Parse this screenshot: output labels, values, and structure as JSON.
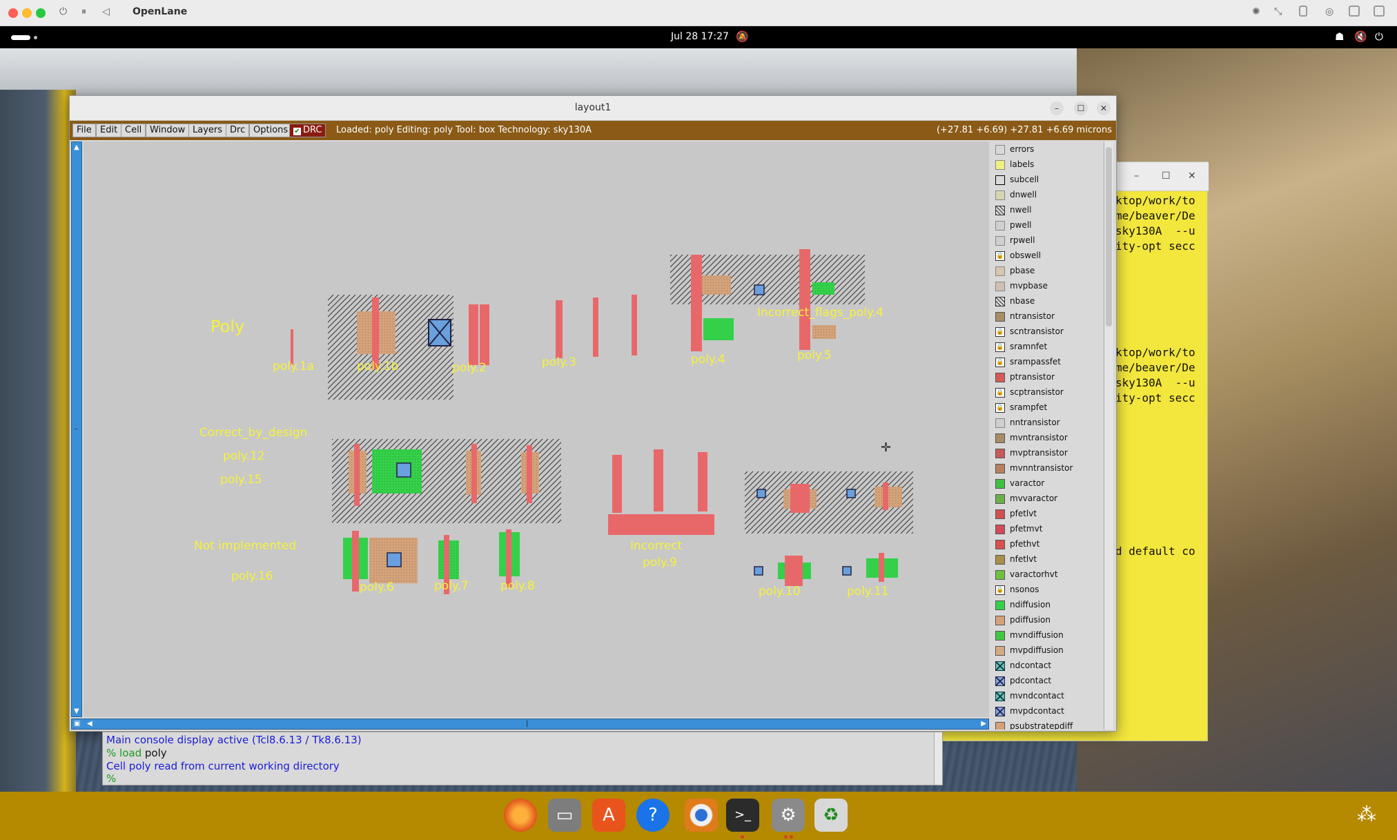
{
  "mac": {
    "title": "OpenLane"
  },
  "ubuntu": {
    "clock": "Jul 28  17:27"
  },
  "terminal": {
    "lines": [
      "ktop/work/to",
      "me/beaver/De",
      "sky130A  --u",
      "ity-opt secc",
      "ktop/work/to",
      "me/beaver/De",
      "sky130A  --u",
      "ity-opt secc",
      "d default co"
    ]
  },
  "magic": {
    "window_title": "layout1",
    "menus": [
      "File",
      "Edit",
      "Cell",
      "Window",
      "Layers",
      "Drc",
      "Options"
    ],
    "drc_label": "DRC",
    "status": "Loaded: poly  Editing: poly  Tool: box   Technology: sky130A",
    "coords": "(+27.81 +6.69) +27.81 +6.69 microns"
  },
  "canvas_labels": {
    "poly": "Poly",
    "poly_1a": "poly.1a",
    "poly_1b": "poly.1b",
    "poly_2": "poly.2",
    "poly_3": "poly.3",
    "poly_4": "poly.4",
    "poly_5": "poly.5",
    "incorrect_flags": "Incorrect_flags_poly.4",
    "correct_by_design": "Correct_by_design",
    "poly_12": "poly.12",
    "poly_15": "poly.15",
    "not_implemented": "Not implemented",
    "poly_16": "poly.16",
    "poly_6": "poly.6",
    "poly_7": "poly.7",
    "poly_8": "poly.8",
    "incorrect": "Incorrect",
    "poly_9": "poly.9",
    "poly_10": "poly.10",
    "poly_11": "poly.11"
  },
  "layers": [
    "errors",
    "labels",
    "subcell",
    "dnwell",
    "nwell",
    "pwell",
    "rpwell",
    "obswell",
    "pbase",
    "mvpbase",
    "nbase",
    "ntransistor",
    "scntransistor",
    "sramnfet",
    "srampassfet",
    "ptransistor",
    "scptransistor",
    "srampfet",
    "nntransistor",
    "mvntransistor",
    "mvptransistor",
    "mvnntransistor",
    "varactor",
    "mvvaractor",
    "pfetlvt",
    "pfetmvt",
    "pfethvt",
    "nfetlvt",
    "varactorhvt",
    "nsonos",
    "ndiffusion",
    "pdiffusion",
    "mvndiffusion",
    "mvpdiffusion",
    "ndcontact",
    "pdcontact",
    "mvndcontact",
    "mvpdcontact",
    "psubstratepdiff"
  ],
  "console": {
    "line1": "Main console display active (Tcl8.6.13 / Tk8.6.13)",
    "prompt": "%",
    "cmd_keyword": "load",
    "cmd_arg": "poly",
    "line3": "Cell poly read from current working directory",
    "line4": "%"
  },
  "colors": {
    "poly": "#e8686a",
    "ndiff": "#35d04a",
    "pdiff": "#d4a27a",
    "label": "#f6f23a",
    "menubar": "#8a5a16",
    "dock": "#b58900"
  }
}
